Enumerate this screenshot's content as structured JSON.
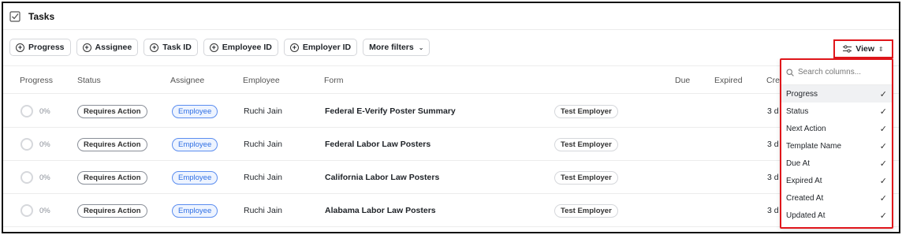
{
  "header": {
    "title": "Tasks",
    "icon": "checkbox-icon"
  },
  "filters": [
    {
      "label": "Progress"
    },
    {
      "label": "Assignee"
    },
    {
      "label": "Task ID"
    },
    {
      "label": "Employee ID"
    },
    {
      "label": "Employer ID"
    }
  ],
  "more_filters": {
    "label": "More filters"
  },
  "view_button": {
    "label": "View"
  },
  "table": {
    "columns": {
      "progress": "Progress",
      "status": "Status",
      "assignee": "Assignee",
      "employee": "Employee",
      "form": "Form",
      "due": "Due",
      "expired": "Expired",
      "created": "Cre"
    },
    "rows": [
      {
        "progress": "0%",
        "status": "Requires Action",
        "assignee": "Employee",
        "employee": "Ruchi Jain",
        "form": "Federal E-Verify Poster Summary",
        "employer": "Test Employer",
        "created": "3 d"
      },
      {
        "progress": "0%",
        "status": "Requires Action",
        "assignee": "Employee",
        "employee": "Ruchi Jain",
        "form": "Federal Labor Law Posters",
        "employer": "Test Employer",
        "created": "3 d"
      },
      {
        "progress": "0%",
        "status": "Requires Action",
        "assignee": "Employee",
        "employee": "Ruchi Jain",
        "form": "California Labor Law Posters",
        "employer": "Test Employer",
        "created": "3 d"
      },
      {
        "progress": "0%",
        "status": "Requires Action",
        "assignee": "Employee",
        "employee": "Ruchi Jain",
        "form": "Alabama Labor Law Posters",
        "employer": "Test Employer",
        "created": "3 d"
      }
    ]
  },
  "column_picker": {
    "search_placeholder": "Search columns...",
    "items": [
      {
        "label": "Progress",
        "checked": true
      },
      {
        "label": "Status",
        "checked": true
      },
      {
        "label": "Next Action",
        "checked": true
      },
      {
        "label": "Template Name",
        "checked": true
      },
      {
        "label": "Due At",
        "checked": true
      },
      {
        "label": "Expired At",
        "checked": true
      },
      {
        "label": "Created At",
        "checked": true
      },
      {
        "label": "Updated At",
        "checked": true
      }
    ],
    "check_glyph": "✓"
  },
  "colors": {
    "highlight_border": "#e0161b",
    "assignee_blue": "#2f6fe4"
  }
}
